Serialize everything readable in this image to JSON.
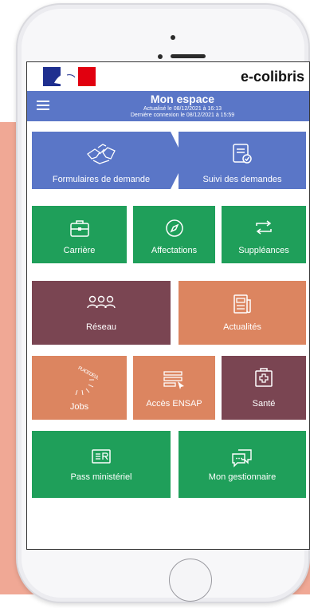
{
  "app": {
    "brand": "e-colibris"
  },
  "header": {
    "title": "Mon espace",
    "updated": "Actualisé le 08/12/2021 à 16:13",
    "last_login": "Dernière connexion le 08/12/2021 à 15:59"
  },
  "tiles": {
    "formulaires": {
      "label": "Formulaires de demande",
      "icon": "hands-bird-icon"
    },
    "suivi": {
      "label": "Suivi des demandes",
      "icon": "document-check-icon"
    },
    "carriere": {
      "label": "Carrière",
      "icon": "briefcase-icon"
    },
    "affectations": {
      "label": "Affectations",
      "icon": "compass-icon"
    },
    "suppleances": {
      "label": "Suppléances",
      "icon": "swap-arrows-icon"
    },
    "reseau": {
      "label": "Réseau",
      "icon": "people-group-icon"
    },
    "actualites": {
      "label": "Actualités",
      "icon": "newspaper-icon"
    },
    "jobs": {
      "label": "Jobs",
      "icon": "place-emploi-public-icon",
      "logo_text": "PLACE DE L'EMPLOI PUBLIC"
    },
    "ensap": {
      "label": "Accès ENSAP",
      "icon": "document-cursor-icon"
    },
    "sante": {
      "label": "Santé",
      "icon": "medical-kit-icon"
    },
    "pass": {
      "label": "Pass ministériel",
      "icon": "id-card-icon"
    },
    "gestionnaire": {
      "label": "Mon gestionnaire",
      "icon": "chat-bubbles-icon"
    }
  },
  "colors": {
    "blue": "#5a76c7",
    "green": "#1f9f5a",
    "plum": "#7a4552",
    "orange": "#dc8560",
    "background": "#f0a895"
  }
}
